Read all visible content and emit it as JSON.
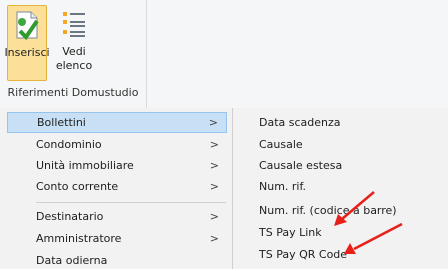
{
  "ribbon": {
    "inserisci_label": "Inserisci",
    "vedi_label_1": "Vedi",
    "vedi_label_2": "elenco",
    "group_label": "Riferimenti Domustudio"
  },
  "menu": {
    "items": [
      {
        "label": "Bollettini",
        "arrow": ">",
        "selected": true
      },
      {
        "label": "Condominio",
        "arrow": ">"
      },
      {
        "label": "Unità immobiliare",
        "arrow": ">"
      },
      {
        "label": "Conto corrente",
        "arrow": ">"
      },
      {
        "label": "Destinatario",
        "arrow": ">"
      },
      {
        "label": "Amministratore",
        "arrow": ">"
      },
      {
        "label": "Data odierna"
      }
    ]
  },
  "submenu": {
    "items": [
      {
        "label": "Data scadenza"
      },
      {
        "label": "Causale"
      },
      {
        "label": "Causale estesa"
      },
      {
        "label": "Num. rif."
      },
      {
        "label": "Num. rif. (codice a barre)"
      },
      {
        "label": "TS Pay Link"
      },
      {
        "label": "TS Pay QR Code"
      }
    ]
  },
  "colors": {
    "annotation_arrow": "#e8201a",
    "selected_bg": "#c8e0f5",
    "ribbon_button_active": "#fcdf99"
  }
}
